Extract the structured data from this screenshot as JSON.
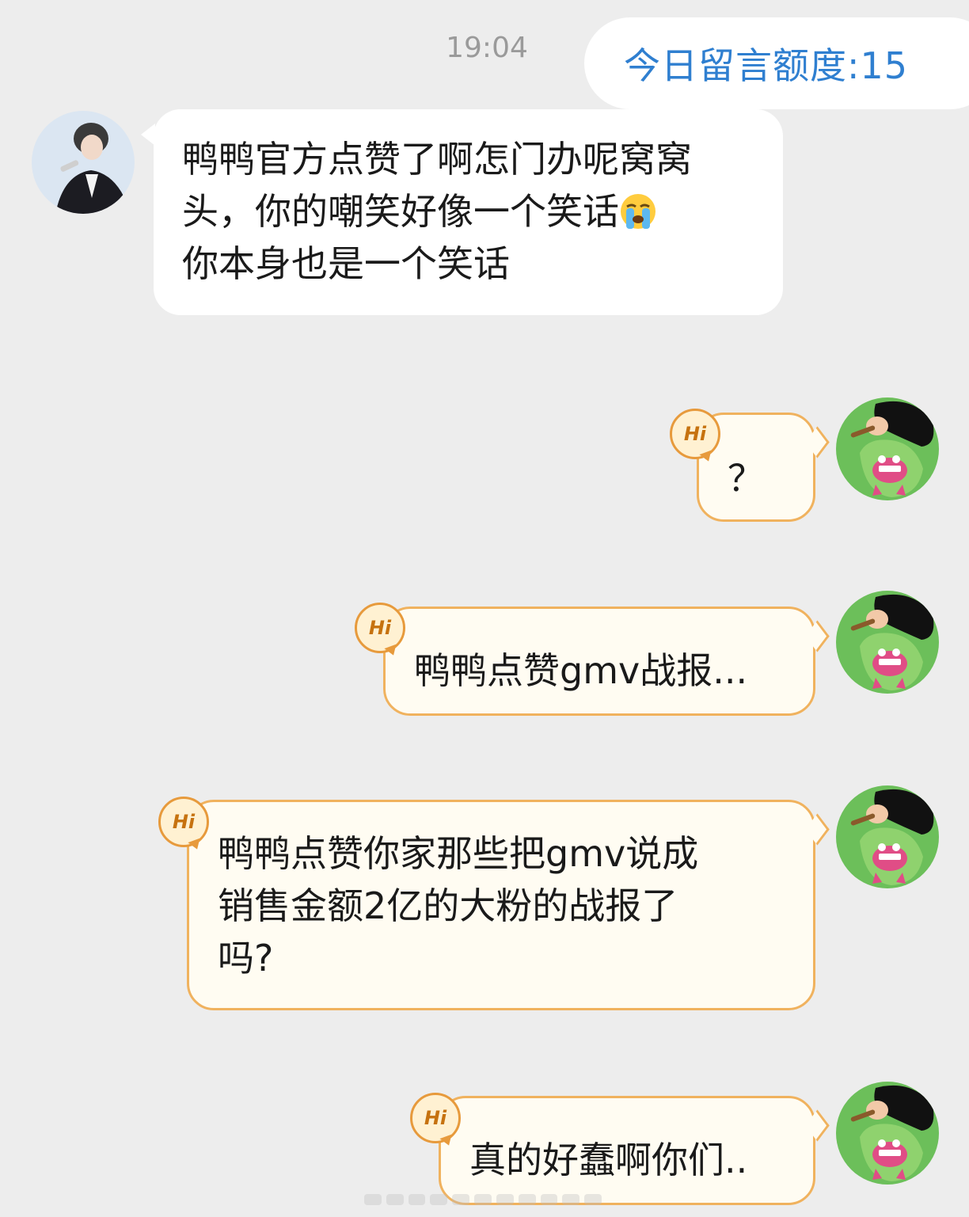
{
  "header": {
    "timestamp": "19:04",
    "quota_label": "今日留言额度:15"
  },
  "incoming": {
    "lines": [
      "鸭鸭官方点赞了啊怎门办呢窝窝",
      "头，你的嘲笑好像一个笑话",
      "你本身也是一个笑话"
    ],
    "emoji": "loudly-crying-face"
  },
  "outgoing": [
    {
      "lines": [
        "？"
      ]
    },
    {
      "lines": [
        "鸭鸭点赞gmv战报..."
      ]
    },
    {
      "lines": [
        "鸭鸭点赞你家那些把gmv说成",
        "销售金额2亿的大粉的战报了",
        "吗?"
      ]
    },
    {
      "lines": [
        "真的好蠢啊你们.."
      ]
    }
  ],
  "badge_label": "Hi",
  "colors": {
    "background": "#ededed",
    "quota_text": "#2f7fd0",
    "bubble_out_border": "#f0b25e",
    "bubble_out_fill": "#fffcf2",
    "avatar_green": "#6cbf5a"
  }
}
